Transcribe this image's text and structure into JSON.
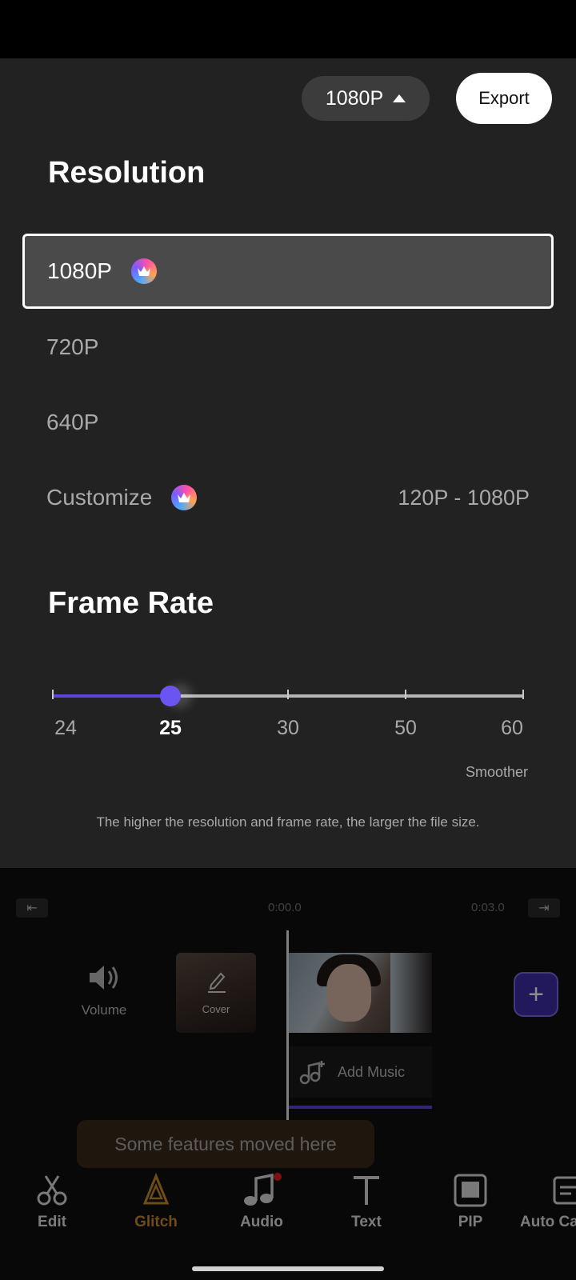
{
  "header": {
    "resolution_pill": "1080P",
    "export_label": "Export"
  },
  "resolution": {
    "title": "Resolution",
    "options": [
      {
        "label": "1080P",
        "selected": true,
        "premium": true
      },
      {
        "label": "720P",
        "selected": false,
        "premium": false
      },
      {
        "label": "640P",
        "selected": false,
        "premium": false
      },
      {
        "label": "Customize",
        "selected": false,
        "premium": true,
        "range": "120P - 1080P"
      }
    ]
  },
  "frame_rate": {
    "title": "Frame Rate",
    "values": [
      "24",
      "25",
      "30",
      "50",
      "60"
    ],
    "current": "25",
    "smoother_label": "Smoother",
    "note": "The higher the resolution and frame rate, the larger the file size."
  },
  "timeline": {
    "time_current": "0:00.0",
    "time_total": "0:03.0",
    "volume_label": "Volume",
    "cover_label": "Cover",
    "add_music_label": "Add Music"
  },
  "toast": "Some features moved here",
  "toolbar": [
    {
      "label": "Edit",
      "icon": "scissors-icon",
      "active": false
    },
    {
      "label": "Glitch",
      "icon": "glitch-icon",
      "active": true
    },
    {
      "label": "Audio",
      "icon": "music-note-icon",
      "active": false
    },
    {
      "label": "Text",
      "icon": "text-icon",
      "active": false
    },
    {
      "label": "PIP",
      "icon": "pip-icon",
      "active": false
    },
    {
      "label": "Auto Ca",
      "icon": "caption-icon",
      "active": false
    }
  ],
  "colors": {
    "sheet_bg": "#222222",
    "accent": "#6a55f0",
    "glitch_active": "#c98a2a"
  }
}
